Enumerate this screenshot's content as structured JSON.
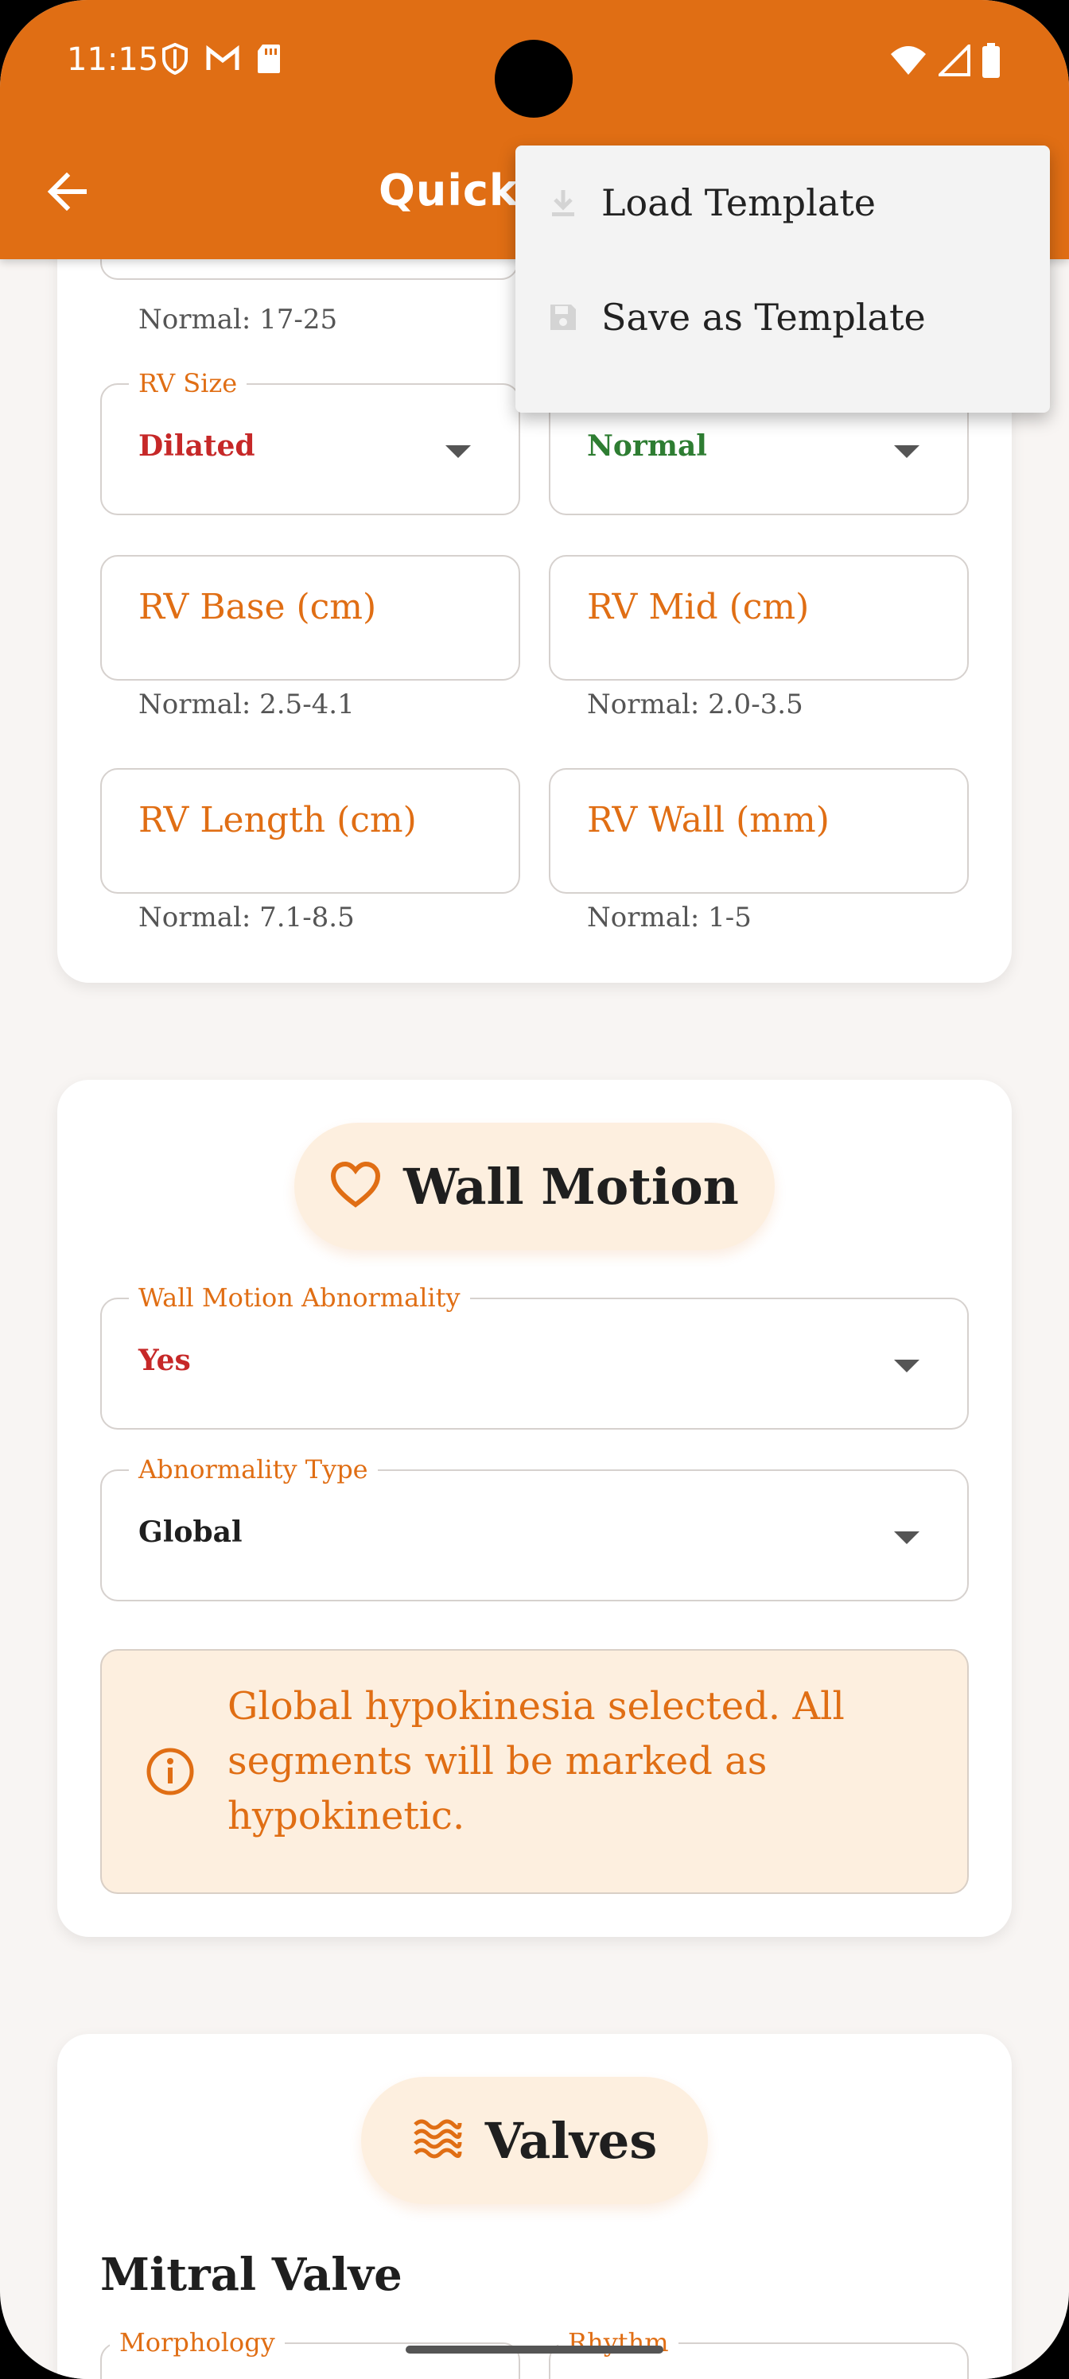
{
  "status_bar": {
    "time": "11:15",
    "left_icons": [
      "shield-icon",
      "gmail-icon",
      "sd-card-icon"
    ],
    "right_icons": [
      "wifi-icon",
      "signal-icon",
      "battery-icon"
    ]
  },
  "app_bar": {
    "title": "Quick",
    "back_icon": "arrow-left-icon",
    "color": "#e06e14"
  },
  "overflow_menu": {
    "items": [
      {
        "label": "Load Template",
        "icon": "download-icon"
      },
      {
        "label": "Save as Template",
        "icon": "save-icon"
      }
    ]
  },
  "right_ventricle": {
    "top_hint": "Normal: 17-25",
    "rv_size": {
      "label": "RV Size",
      "value": "Dilated",
      "value_color": "#c62828"
    },
    "rv_function": {
      "value": "Normal",
      "value_color": "#2e7d32"
    },
    "rv_base": {
      "placeholder": "RV Base (cm)",
      "hint": "Normal: 2.5-4.1"
    },
    "rv_mid": {
      "placeholder": "RV Mid (cm)",
      "hint": "Normal: 2.0-3.5"
    },
    "rv_length": {
      "placeholder": "RV Length (cm)",
      "hint": "Normal: 7.1-8.5"
    },
    "rv_wall": {
      "placeholder": "RV Wall (mm)",
      "hint": "Normal: 1-5"
    }
  },
  "wall_motion": {
    "title": "Wall Motion",
    "icon": "heart-icon",
    "abnormality": {
      "label": "Wall Motion Abnormality",
      "value": "Yes",
      "value_color": "#c62828"
    },
    "abnormality_type": {
      "label": "Abnormality Type",
      "value": "Global"
    },
    "info_icon": "info-icon",
    "info_text": "Global hypokinesia selected. All segments will be marked as hypokinetic."
  },
  "valves": {
    "title": "Valves",
    "icon": "waves-icon",
    "mitral_heading": "Mitral Valve",
    "morphology_label": "Morphology",
    "rhythm_label": "Rhythm"
  }
}
